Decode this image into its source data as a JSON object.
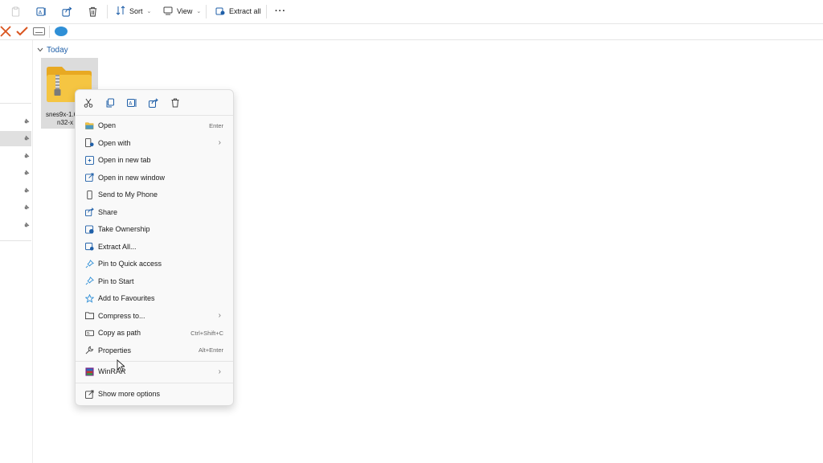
{
  "toolbar": {
    "sort_label": "Sort",
    "view_label": "View",
    "extract_all_label": "Extract all",
    "more_label": "···"
  },
  "group": {
    "label": "Today"
  },
  "file": {
    "name_line1": "snes9x-1.6",
    "name_line2": "n32-x"
  },
  "context_menu": {
    "items": [
      {
        "label": "Open",
        "shortcut": "Enter",
        "icon": "folder-open-icon"
      },
      {
        "label": "Open with",
        "submenu": true,
        "icon": "open-with-icon"
      },
      {
        "label": "Open in new tab",
        "icon": "new-tab-icon"
      },
      {
        "label": "Open in new window",
        "icon": "new-window-icon"
      },
      {
        "label": "Send to My Phone",
        "icon": "phone-icon"
      },
      {
        "label": "Share",
        "icon": "share-icon"
      },
      {
        "label": "Take Ownership",
        "icon": "ownership-icon"
      },
      {
        "label": "Extract All...",
        "icon": "extract-icon"
      },
      {
        "label": "Pin to Quick access",
        "icon": "pin-icon"
      },
      {
        "label": "Pin to Start",
        "icon": "pin-icon"
      },
      {
        "label": "Add to Favourites",
        "icon": "star-icon"
      },
      {
        "label": "Compress to...",
        "submenu": true,
        "icon": "compress-icon"
      },
      {
        "label": "Copy as path",
        "shortcut": "Ctrl+Shift+C",
        "icon": "copy-path-icon"
      },
      {
        "label": "Properties",
        "shortcut": "Alt+Enter",
        "icon": "wrench-icon"
      }
    ],
    "winrar": {
      "label": "WinRAR",
      "submenu": true,
      "icon": "winrar-icon"
    },
    "more_options": {
      "label": "Show more options",
      "icon": "more-options-icon"
    }
  },
  "colors": {
    "accent": "#1f5fa8",
    "folder": "#f5c542",
    "cancel": "#d9541e",
    "confirm": "#d9541e"
  }
}
